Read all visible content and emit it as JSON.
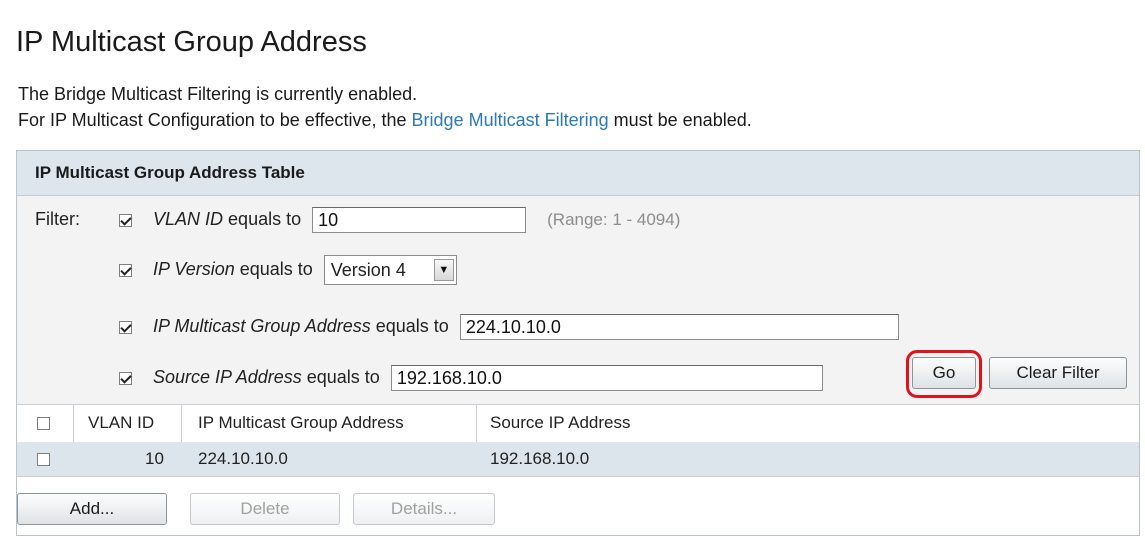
{
  "page": {
    "title": "IP Multicast Group Address",
    "info_line1": "The Bridge Multicast Filtering is currently enabled.",
    "info_line2_before": "For IP Multicast Configuration to be effective, the ",
    "info_line2_link": "Bridge Multicast Filtering",
    "info_line2_after": " must be enabled."
  },
  "table": {
    "header": "IP Multicast Group Address Table",
    "filter_label": "Filter:",
    "filters": {
      "vlan": {
        "checked": true,
        "field": "VLAN ID",
        "op": " equals to ",
        "value": "10",
        "hint": "(Range: 1 - 4094)"
      },
      "ip_version": {
        "checked": true,
        "field": "IP Version",
        "op": " equals to ",
        "value": "Version 4"
      },
      "group_address": {
        "checked": true,
        "field": "IP Multicast Group Address",
        "op": " equals to ",
        "value": "224.10.10.0"
      },
      "source_ip": {
        "checked": true,
        "field": "Source IP Address",
        "op": " equals to ",
        "value": "192.168.10.0"
      }
    },
    "go_label": "Go",
    "clear_filter_label": "Clear Filter",
    "columns": [
      "VLAN ID",
      "IP Multicast Group Address",
      "Source IP Address"
    ],
    "rows": [
      {
        "vlan_id": "10",
        "group_address": "224.10.10.0",
        "source_ip": "192.168.10.0"
      }
    ],
    "actions": {
      "add": "Add...",
      "delete": "Delete",
      "details": "Details..."
    }
  },
  "colors": {
    "highlight": "#e0121a",
    "link": "#2a7ab8",
    "header_bg": "#dde6ec"
  }
}
